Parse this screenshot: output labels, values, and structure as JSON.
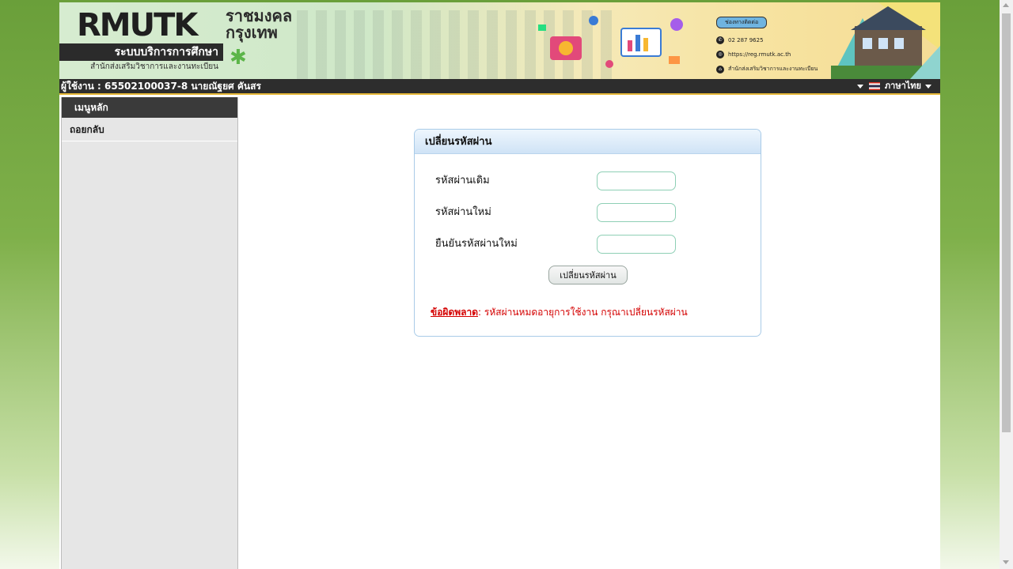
{
  "banner": {
    "logo_text": "RMUTK",
    "logo_thai_line1": "ราชมงคล",
    "logo_thai_line2": "กรุงเทพ",
    "system_name": "ระบบบริการการศึกษา",
    "office_name": "สำนักส่งเสริมวิชาการและงานทะเบียน",
    "contact_tag": "ช่องทางติดต่อ",
    "contact_phone": "02 287 9625",
    "contact_web": "https://reg.rmutk.ac.th",
    "contact_office": "สำนักส่งเสริมวิชาการและงานทะเบียน"
  },
  "userbar": {
    "user_label": "ผู้ใช้งาน : 65502100037-8 นายณัฐยศ คันสร",
    "language": "ภาษาไทย"
  },
  "sidebar": {
    "title": "เมนูหลัก",
    "items": [
      {
        "label": "ถอยกลับ"
      }
    ]
  },
  "change_password": {
    "title": "เปลี่ยนรหัสผ่าน",
    "old_password_label": "รหัสผ่านเดิม",
    "new_password_label": "รหัสผ่านใหม่",
    "confirm_password_label": "ยืนยันรหัสผ่านใหม่",
    "old_password_value": "",
    "new_password_value": "",
    "confirm_password_value": "",
    "submit_label": "เปลี่ยนรหัสผ่าน",
    "error_label": "ข้อผิดพลาด",
    "error_message": ": รหัสผ่านหมดอายุการใช้งาน กรุณาเปลี่ยนรหัสผ่าน"
  },
  "colors": {
    "accent_green": "#5bb548",
    "error_red": "#d40000",
    "header_dark": "#2d2d2d",
    "panel_border": "#a9cbe8"
  }
}
